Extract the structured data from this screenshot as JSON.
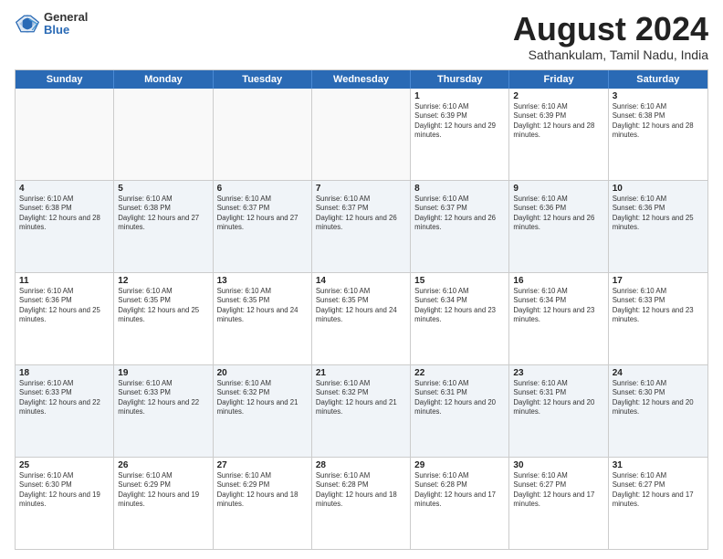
{
  "logo": {
    "general": "General",
    "blue": "Blue"
  },
  "title": {
    "month_year": "August 2024",
    "location": "Sathankulam, Tamil Nadu, India"
  },
  "days_of_week": [
    "Sunday",
    "Monday",
    "Tuesday",
    "Wednesday",
    "Thursday",
    "Friday",
    "Saturday"
  ],
  "weeks": [
    [
      {
        "day": "",
        "text": ""
      },
      {
        "day": "",
        "text": ""
      },
      {
        "day": "",
        "text": ""
      },
      {
        "day": "",
        "text": ""
      },
      {
        "day": "1",
        "text": "Sunrise: 6:10 AM\nSunset: 6:39 PM\nDaylight: 12 hours and 29 minutes."
      },
      {
        "day": "2",
        "text": "Sunrise: 6:10 AM\nSunset: 6:39 PM\nDaylight: 12 hours and 28 minutes."
      },
      {
        "day": "3",
        "text": "Sunrise: 6:10 AM\nSunset: 6:38 PM\nDaylight: 12 hours and 28 minutes."
      }
    ],
    [
      {
        "day": "4",
        "text": "Sunrise: 6:10 AM\nSunset: 6:38 PM\nDaylight: 12 hours and 28 minutes."
      },
      {
        "day": "5",
        "text": "Sunrise: 6:10 AM\nSunset: 6:38 PM\nDaylight: 12 hours and 27 minutes."
      },
      {
        "day": "6",
        "text": "Sunrise: 6:10 AM\nSunset: 6:37 PM\nDaylight: 12 hours and 27 minutes."
      },
      {
        "day": "7",
        "text": "Sunrise: 6:10 AM\nSunset: 6:37 PM\nDaylight: 12 hours and 26 minutes."
      },
      {
        "day": "8",
        "text": "Sunrise: 6:10 AM\nSunset: 6:37 PM\nDaylight: 12 hours and 26 minutes."
      },
      {
        "day": "9",
        "text": "Sunrise: 6:10 AM\nSunset: 6:36 PM\nDaylight: 12 hours and 26 minutes."
      },
      {
        "day": "10",
        "text": "Sunrise: 6:10 AM\nSunset: 6:36 PM\nDaylight: 12 hours and 25 minutes."
      }
    ],
    [
      {
        "day": "11",
        "text": "Sunrise: 6:10 AM\nSunset: 6:36 PM\nDaylight: 12 hours and 25 minutes."
      },
      {
        "day": "12",
        "text": "Sunrise: 6:10 AM\nSunset: 6:35 PM\nDaylight: 12 hours and 25 minutes."
      },
      {
        "day": "13",
        "text": "Sunrise: 6:10 AM\nSunset: 6:35 PM\nDaylight: 12 hours and 24 minutes."
      },
      {
        "day": "14",
        "text": "Sunrise: 6:10 AM\nSunset: 6:35 PM\nDaylight: 12 hours and 24 minutes."
      },
      {
        "day": "15",
        "text": "Sunrise: 6:10 AM\nSunset: 6:34 PM\nDaylight: 12 hours and 23 minutes."
      },
      {
        "day": "16",
        "text": "Sunrise: 6:10 AM\nSunset: 6:34 PM\nDaylight: 12 hours and 23 minutes."
      },
      {
        "day": "17",
        "text": "Sunrise: 6:10 AM\nSunset: 6:33 PM\nDaylight: 12 hours and 23 minutes."
      }
    ],
    [
      {
        "day": "18",
        "text": "Sunrise: 6:10 AM\nSunset: 6:33 PM\nDaylight: 12 hours and 22 minutes."
      },
      {
        "day": "19",
        "text": "Sunrise: 6:10 AM\nSunset: 6:33 PM\nDaylight: 12 hours and 22 minutes."
      },
      {
        "day": "20",
        "text": "Sunrise: 6:10 AM\nSunset: 6:32 PM\nDaylight: 12 hours and 21 minutes."
      },
      {
        "day": "21",
        "text": "Sunrise: 6:10 AM\nSunset: 6:32 PM\nDaylight: 12 hours and 21 minutes."
      },
      {
        "day": "22",
        "text": "Sunrise: 6:10 AM\nSunset: 6:31 PM\nDaylight: 12 hours and 20 minutes."
      },
      {
        "day": "23",
        "text": "Sunrise: 6:10 AM\nSunset: 6:31 PM\nDaylight: 12 hours and 20 minutes."
      },
      {
        "day": "24",
        "text": "Sunrise: 6:10 AM\nSunset: 6:30 PM\nDaylight: 12 hours and 20 minutes."
      }
    ],
    [
      {
        "day": "25",
        "text": "Sunrise: 6:10 AM\nSunset: 6:30 PM\nDaylight: 12 hours and 19 minutes."
      },
      {
        "day": "26",
        "text": "Sunrise: 6:10 AM\nSunset: 6:29 PM\nDaylight: 12 hours and 19 minutes."
      },
      {
        "day": "27",
        "text": "Sunrise: 6:10 AM\nSunset: 6:29 PM\nDaylight: 12 hours and 18 minutes."
      },
      {
        "day": "28",
        "text": "Sunrise: 6:10 AM\nSunset: 6:28 PM\nDaylight: 12 hours and 18 minutes."
      },
      {
        "day": "29",
        "text": "Sunrise: 6:10 AM\nSunset: 6:28 PM\nDaylight: 12 hours and 17 minutes."
      },
      {
        "day": "30",
        "text": "Sunrise: 6:10 AM\nSunset: 6:27 PM\nDaylight: 12 hours and 17 minutes."
      },
      {
        "day": "31",
        "text": "Sunrise: 6:10 AM\nSunset: 6:27 PM\nDaylight: 12 hours and 17 minutes."
      }
    ]
  ]
}
